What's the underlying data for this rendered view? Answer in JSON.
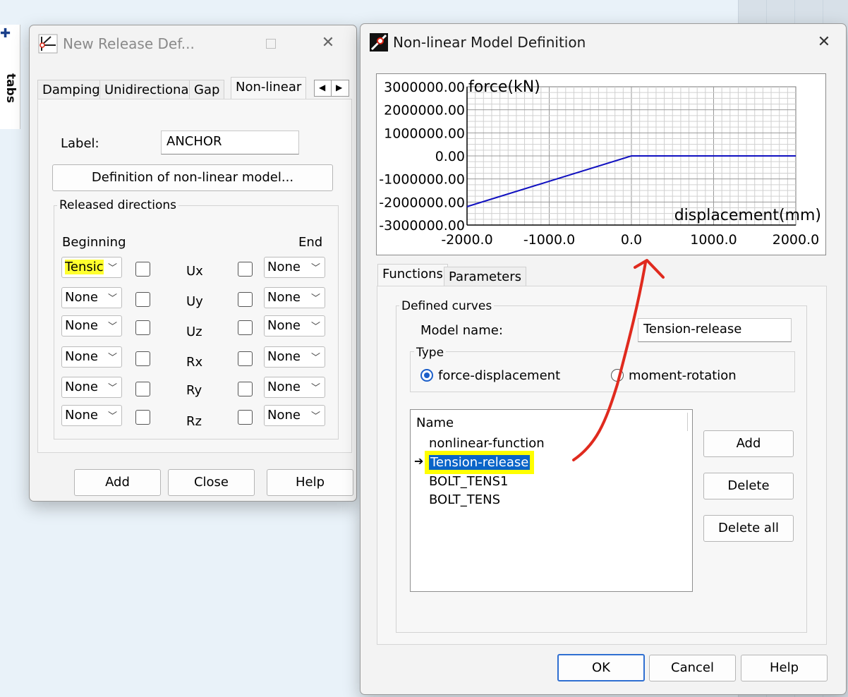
{
  "sidetab": {
    "label": "tabs"
  },
  "release_window": {
    "title": "New Release Def...",
    "tabs": [
      "Damping",
      "Unidirectional",
      "Gap",
      "Non-linear"
    ],
    "label_caption": "Label:",
    "label_value": "ANCHOR",
    "definition_button": "Definition of non-linear model...",
    "released_directions": "Released directions",
    "beginning": "Beginning",
    "end": "End",
    "rows": [
      {
        "dof": "Ux",
        "begin": "Tensic",
        "end": "None"
      },
      {
        "dof": "Uy",
        "begin": "None",
        "end": "None"
      },
      {
        "dof": "Uz",
        "begin": "None",
        "end": "None"
      },
      {
        "dof": "Rx",
        "begin": "None",
        "end": "None"
      },
      {
        "dof": "Ry",
        "begin": "None",
        "end": "None"
      },
      {
        "dof": "Rz",
        "begin": "None",
        "end": "None"
      }
    ],
    "buttons": {
      "add": "Add",
      "close": "Close",
      "help": "Help"
    },
    "highlight_color": "#ffff2e"
  },
  "nonlinear_window": {
    "title": "Non-linear Model Definition",
    "tabs": [
      "Functions",
      "Parameters"
    ],
    "defined_curves": "Defined curves",
    "model_name_caption": "Model name:",
    "model_name_value": "Tension-release",
    "type_label": "Type",
    "type_options": {
      "force_displacement": "force-displacement",
      "moment_rotation": "moment-rotation"
    },
    "type_selected": "force-displacement",
    "list_header": "Name",
    "list_items": [
      "nonlinear-function",
      "Tension-release",
      "BOLT_TENS1",
      "BOLT_TENS"
    ],
    "selected_item": "Tension-release",
    "side_buttons": {
      "add": "Add",
      "delete": "Delete",
      "delete_all": "Delete all"
    },
    "bottom_buttons": {
      "ok": "OK",
      "cancel": "Cancel",
      "help": "Help"
    },
    "selection_color": "#0a64c8",
    "annotation_arrow_color": "#e02a1e"
  },
  "chart_data": {
    "type": "line",
    "title": "",
    "xlabel": "displacement(mm)",
    "ylabel": "force(kN)",
    "xlim": [
      -2000,
      2000
    ],
    "ylim": [
      -3000000,
      3000000
    ],
    "x_ticks": [
      "-2000.0",
      "-1000.0",
      "0.0",
      "1000.0",
      "2000.0"
    ],
    "y_ticks": [
      "3000000.00",
      "2000000.00",
      "1000000.00",
      "0.00",
      "-1000000.00",
      "-2000000.00",
      "-3000000.00"
    ],
    "grid": true,
    "series": [
      {
        "x": [
          -2000,
          0,
          2000
        ],
        "y": [
          -2200000,
          0,
          0
        ],
        "color": "#1010c0"
      }
    ]
  }
}
